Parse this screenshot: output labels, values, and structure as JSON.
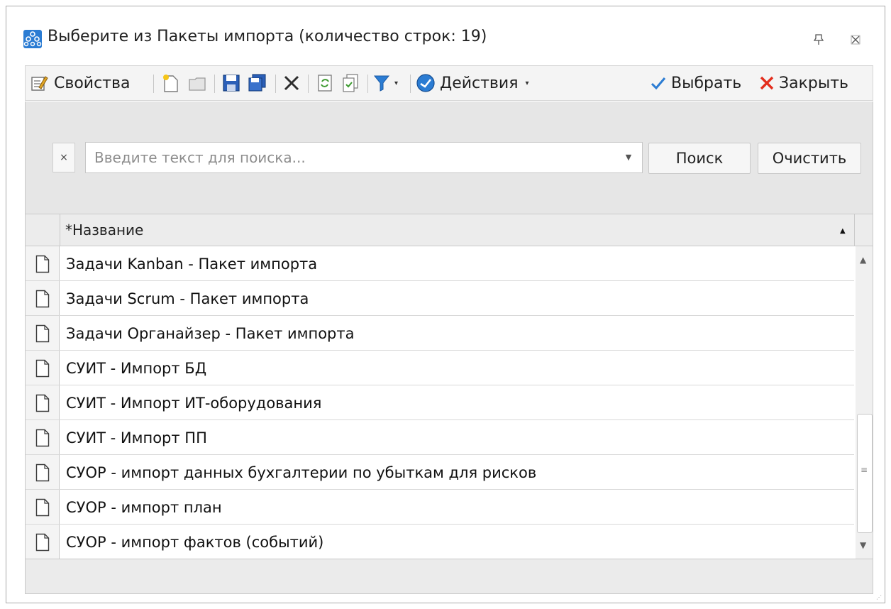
{
  "window": {
    "title": "Выберите из Пакеты импорта (количество строк: 19)",
    "pin_icon": "pin-icon",
    "close_icon": "close-icon"
  },
  "toolbar": {
    "properties_label": "Свойства",
    "actions_label": "Действия",
    "select_label": "Выбрать",
    "close_label": "Закрыть",
    "accent_green": "#3c9a2f",
    "accent_red": "#e32d1c",
    "accent_blue": "#2b7cd3"
  },
  "search": {
    "placeholder": "Введите текст для поиска...",
    "value": "",
    "clear_x": "×",
    "search_button": "Поиск",
    "clear_button": "Очистить"
  },
  "grid": {
    "column_header": "*Название",
    "sort": "ascending",
    "rows": [
      "Задачи Kanban - Пакет импорта",
      "Задачи Scrum - Пакет импорта",
      "Задачи Органайзер - Пакет импорта",
      "СУИТ - Импорт БД",
      "СУИТ - Импорт ИТ-оборудования",
      "СУИТ - Импорт ПП",
      "СУОР - импорт данных бухгалтерии по убыткам для рисков",
      "СУОР - импорт план",
      "СУОР - импорт фактов (событий)"
    ]
  }
}
